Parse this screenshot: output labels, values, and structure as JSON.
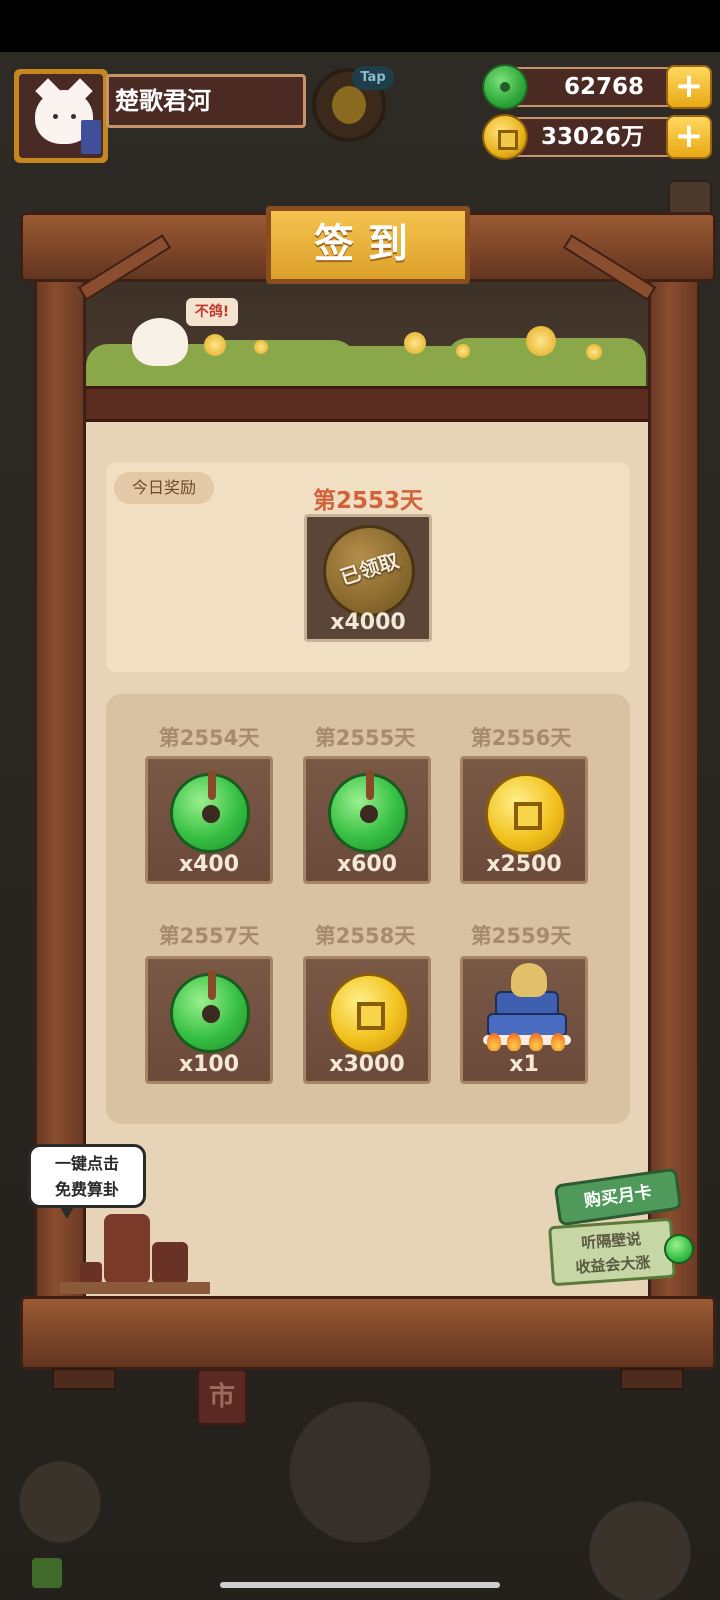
{
  "header": {
    "player_name": "楚歌君河",
    "tap_hint": "Tap",
    "jade_amount": "62768",
    "coin_amount": "33026万",
    "plus_label": "+"
  },
  "signin": {
    "title": "签到",
    "mascot_bubble": "不鸽!",
    "today": {
      "label": "今日奖励",
      "day": "第2553天",
      "status": "已领取",
      "qty": "x4000",
      "reward_icon": "coin-icon"
    },
    "upcoming": [
      {
        "day": "第2554天",
        "reward_icon": "jade-icon",
        "qty": "x400"
      },
      {
        "day": "第2555天",
        "reward_icon": "jade-icon",
        "qty": "x600"
      },
      {
        "day": "第2556天",
        "reward_icon": "coin-icon",
        "qty": "x2500"
      },
      {
        "day": "第2557天",
        "reward_icon": "jade-icon",
        "qty": "x100"
      },
      {
        "day": "第2558天",
        "reward_icon": "coin-icon",
        "qty": "x3000"
      },
      {
        "day": "第2559天",
        "reward_icon": "dragon-cake-icon",
        "qty": "x1"
      }
    ]
  },
  "widgets": {
    "divine_line1": "一键点击",
    "divine_line2": "免费算卦",
    "month_card_title": "购买月卡",
    "month_card_line1": "听隔壁说",
    "month_card_line2": "收益会大涨"
  },
  "background_signs": [
    "市"
  ],
  "colors": {
    "accent_gold": "#f0bd45",
    "wood": "#7a4327",
    "panel": "#e7d3b5",
    "day_highlight": "#d0633a"
  }
}
